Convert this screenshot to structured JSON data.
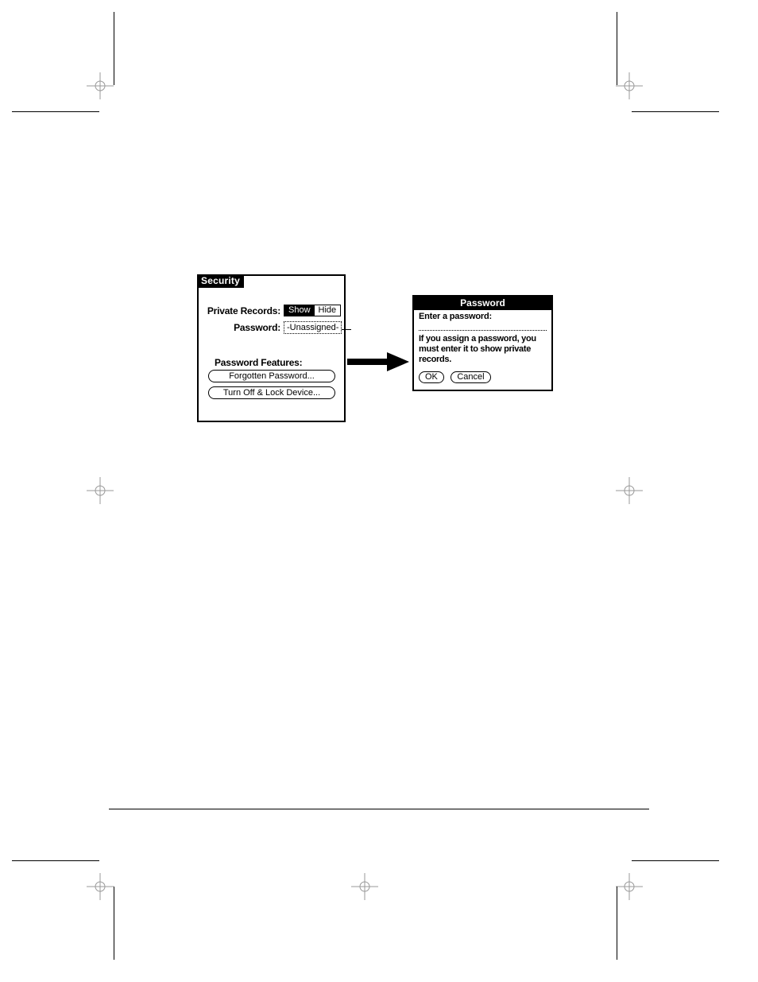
{
  "security": {
    "title": "Security",
    "private_records_label": "Private Records:",
    "show_label": "Show",
    "hide_label": "Hide",
    "password_label": "Password:",
    "password_value": "-Unassigned-",
    "features_label": "Password Features:",
    "forgotten_button": "Forgotten Password...",
    "turnoff_button": "Turn Off & Lock Device..."
  },
  "password_dialog": {
    "title": "Password",
    "prompt": "Enter a password:",
    "message": "If you assign a password, you must enter it to show private records.",
    "ok_label": "OK",
    "cancel_label": "Cancel"
  }
}
